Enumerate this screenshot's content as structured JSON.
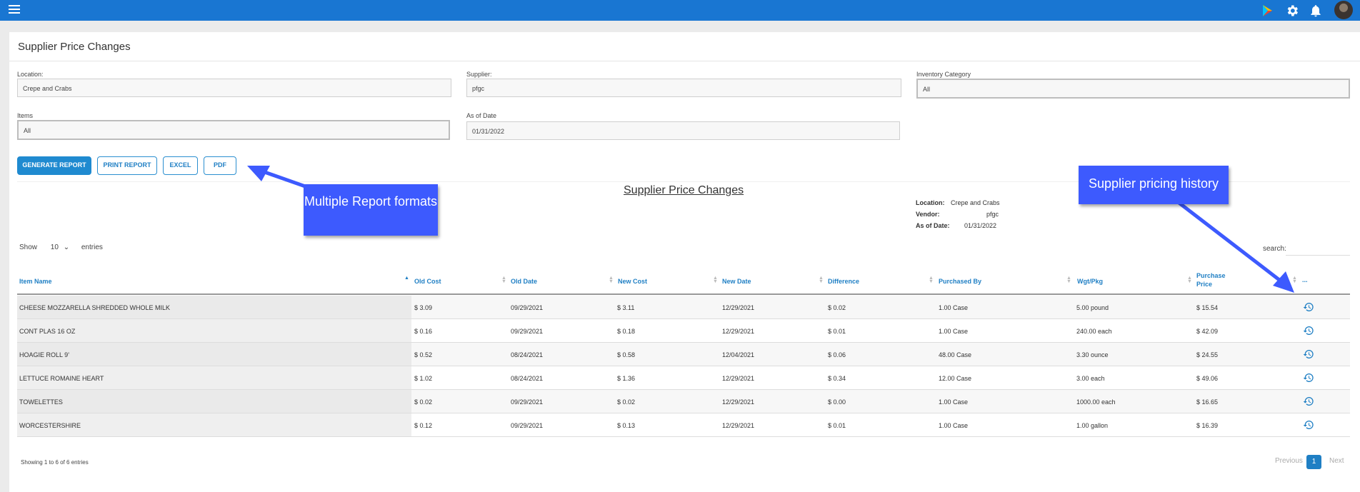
{
  "page": {
    "title": "Supplier Price Changes"
  },
  "filters": {
    "location": {
      "label": "Location:",
      "value": "Crepe and Crabs"
    },
    "supplier": {
      "label": "Supplier:",
      "value": "pfgc"
    },
    "inventory_category": {
      "label": "Inventory Category",
      "value": "All"
    },
    "items": {
      "label": "Items",
      "value": "All"
    },
    "as_of_date": {
      "label": "As of Date",
      "value": "01/31/2022"
    }
  },
  "buttons": {
    "generate": "GENERATE REPORT",
    "print": "PRINT REPORT",
    "excel": "EXCEL",
    "pdf": "PDF"
  },
  "report": {
    "title": "Supplier Price Changes",
    "location_label": "Location:",
    "location_value": "Crepe and Crabs",
    "vendor_label": "Vendor:",
    "vendor_value": "pfgc",
    "date_label": "As of Date:",
    "date_value": "01/31/2022"
  },
  "callouts": {
    "formats": "Multiple Report formats",
    "history": "Supplier pricing history"
  },
  "table_controls": {
    "show": "Show",
    "entries_value": "10",
    "entries": "entries",
    "search": "search:"
  },
  "columns": {
    "item_name": "Item Name",
    "old_cost": "Old Cost",
    "old_date": "Old Date",
    "new_cost": "New Cost",
    "new_date": "New Date",
    "difference": "Difference",
    "purchased_by": "Purchased By",
    "wgt_pkg": "Wgt/Pkg",
    "purchase_price_1": "Purchase",
    "purchase_price_2": "Price",
    "actions": "..."
  },
  "rows": [
    {
      "name": "CHEESE MOZZARELLA SHREDDED WHOLE MILK",
      "old_cost": "$ 3.09",
      "old_date": "09/29/2021",
      "new_cost": "$ 3.11",
      "new_date": "12/29/2021",
      "difference": "$ 0.02",
      "purchased_by": "1.00 Case",
      "wgt_pkg": "5.00 pound",
      "purchase_price": "$ 15.54"
    },
    {
      "name": "CONT PLAS 16 OZ",
      "old_cost": "$ 0.16",
      "old_date": "09/29/2021",
      "new_cost": "$ 0.18",
      "new_date": "12/29/2021",
      "difference": "$ 0.01",
      "purchased_by": "1.00 Case",
      "wgt_pkg": "240.00 each",
      "purchase_price": "$ 42.09"
    },
    {
      "name": "HOAGIE ROLL 9'",
      "old_cost": "$ 0.52",
      "old_date": "08/24/2021",
      "new_cost": "$ 0.58",
      "new_date": "12/04/2021",
      "difference": "$ 0.06",
      "purchased_by": "48.00 Case",
      "wgt_pkg": "3.30 ounce",
      "purchase_price": "$ 24.55"
    },
    {
      "name": "LETTUCE ROMAINE HEART",
      "old_cost": "$ 1.02",
      "old_date": "08/24/2021",
      "new_cost": "$ 1.36",
      "new_date": "12/29/2021",
      "difference": "$ 0.34",
      "purchased_by": "12.00 Case",
      "wgt_pkg": "3.00 each",
      "purchase_price": "$ 49.06"
    },
    {
      "name": "TOWELETTES",
      "old_cost": "$ 0.02",
      "old_date": "09/29/2021",
      "new_cost": "$ 0.02",
      "new_date": "12/29/2021",
      "difference": "$ 0.00",
      "purchased_by": "1.00 Case",
      "wgt_pkg": "1000.00 each",
      "purchase_price": "$ 16.65"
    },
    {
      "name": "WORCESTERSHIRE",
      "old_cost": "$ 0.12",
      "old_date": "09/29/2021",
      "new_cost": "$ 0.13",
      "new_date": "12/29/2021",
      "difference": "$ 0.01",
      "purchased_by": "1.00 Case",
      "wgt_pkg": "1.00 gallon",
      "purchase_price": "$ 16.39"
    }
  ],
  "footer": {
    "info": "Showing 1 to 6 of 6 entries",
    "previous": "Previous",
    "current_page": "1",
    "next": "Next"
  },
  "colors": {
    "topbar": "#1976d2",
    "accent": "#1f7fc4",
    "callout": "#3d5afe"
  }
}
